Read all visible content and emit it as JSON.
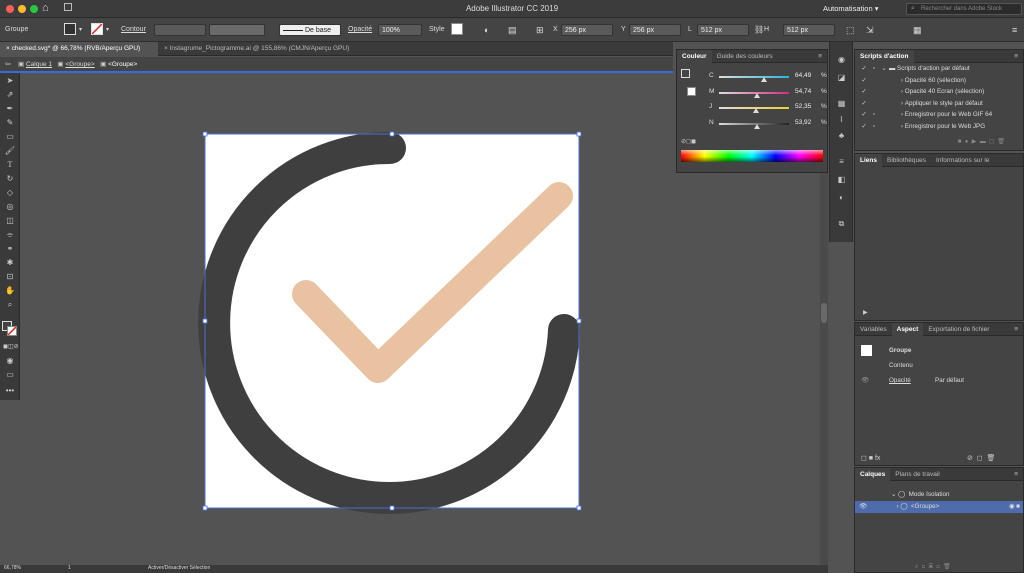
{
  "window": {
    "title": "Adobe Illustrator CC 2019",
    "workspace": "Automatisation",
    "search_placeholder": "Rechercher dans Adobe Stock"
  },
  "control_bar": {
    "selection_type": "Groupe",
    "stroke_label": "Contour",
    "stroke_profile": "De base",
    "opacity_label": "Opacité",
    "opacity_value": "100%",
    "style_label": "Style",
    "x_label": "X",
    "x_value": "256 px",
    "y_label": "Y",
    "y_value": "256 px",
    "w_label": "L",
    "w_value": "512 px",
    "h_label": "H",
    "h_value": "512 px"
  },
  "tabs": [
    {
      "label": "checked.svg* @ 66,78% (RVB/Aperçu GPU)",
      "active": true
    },
    {
      "label": "Instagrume_Pictogramme.ai @ 155,86% (CMJN/Aperçu GPU)",
      "active": false
    }
  ],
  "breadcrumb": [
    "Calque 1",
    "<Groupe>",
    "<Groupe>"
  ],
  "color_panel": {
    "tabs": [
      "Couleur",
      "Guide des couleurs"
    ],
    "channels": [
      {
        "label": "C",
        "value": "64,49",
        "unit": "%",
        "level": 0.6449
      },
      {
        "label": "M",
        "value": "54,74",
        "unit": "%",
        "level": 0.5474
      },
      {
        "label": "J",
        "value": "52,35",
        "unit": "%",
        "level": 0.5235
      },
      {
        "label": "N",
        "value": "53,92",
        "unit": "%",
        "level": 0.5392
      }
    ]
  },
  "actions_panel": {
    "title": "Scripts d'action",
    "set_name": "Scripts d'action par défaut",
    "items": [
      "Opacité 60 (sélection)",
      "Opacité 40 Ecran (sélection)",
      "Appliquer le style par défaut",
      "Enregistrer pour le Web GIF 64",
      "Enregistrer pour le Web JPG"
    ]
  },
  "links_panel": {
    "tabs": [
      "Liens",
      "Bibliothèques",
      "Informations sur le"
    ]
  },
  "appearance_panel": {
    "tabs": [
      "Variables",
      "Aspect",
      "Exportation de fichier"
    ],
    "object": "Groupe",
    "content": "Contenu",
    "opacity_label": "Opacité",
    "opacity_value": "Par défaut"
  },
  "layers_panel": {
    "tabs": [
      "Calques",
      "Plans de travail"
    ],
    "rows": [
      "Mode Isolation",
      "<Groupe>"
    ]
  },
  "artwork": {
    "circle_color": "#3f3f3f",
    "check_color": "#e8c2a1",
    "artboard_color": "#ffffff"
  },
  "status": {
    "zoom": "66,78%",
    "page": "1",
    "info": "Activer/Désactiver Sélection"
  }
}
